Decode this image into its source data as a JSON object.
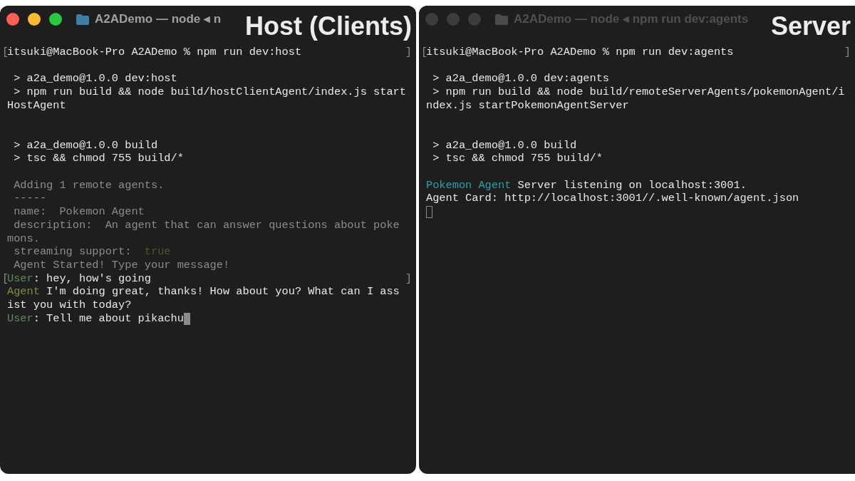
{
  "windows": [
    {
      "title": "A2ADemo — node ◂ n",
      "active": true,
      "overlay_label": "Host (Clients)",
      "lines": [
        {
          "kind": "text",
          "open_bracket": "[",
          "close_bracket": "]",
          "segments": [
            {
              "kind": "normal",
              "text": "itsuki@MacBook-Pro A2ADemo % npm run dev:host"
            }
          ]
        },
        {
          "kind": "blank"
        },
        {
          "kind": "text",
          "segments": [
            {
              "kind": "normal",
              "text": " > a2a_demo@1.0.0 dev:host"
            }
          ]
        },
        {
          "kind": "text",
          "segments": [
            {
              "kind": "normal",
              "text": " > npm run build && node build/hostClientAgent/index.js start"
            }
          ]
        },
        {
          "kind": "text",
          "segments": [
            {
              "kind": "normal",
              "text": "HostAgent"
            }
          ]
        },
        {
          "kind": "blank"
        },
        {
          "kind": "blank"
        },
        {
          "kind": "text",
          "segments": [
            {
              "kind": "normal",
              "text": " > a2a_demo@1.0.0 build"
            }
          ]
        },
        {
          "kind": "text",
          "segments": [
            {
              "kind": "normal",
              "text": " > tsc && chmod 755 build/*"
            }
          ]
        },
        {
          "kind": "blank"
        },
        {
          "kind": "text",
          "segments": [
            {
              "kind": "dim",
              "text": " Adding 1 remote agents."
            }
          ]
        },
        {
          "kind": "text",
          "segments": [
            {
              "kind": "dim",
              "text": " -----"
            }
          ]
        },
        {
          "kind": "text",
          "segments": [
            {
              "kind": "dim",
              "text": " name:  Pokemon Agent"
            }
          ]
        },
        {
          "kind": "text",
          "segments": [
            {
              "kind": "dim",
              "text": " description:  An agent that can answer questions about poke"
            }
          ]
        },
        {
          "kind": "text",
          "segments": [
            {
              "kind": "dim",
              "text": "mons."
            }
          ]
        },
        {
          "kind": "text",
          "segments": [
            {
              "kind": "dim",
              "text": " streaming support:  "
            },
            {
              "kind": "faint_olive",
              "text": "true"
            }
          ]
        },
        {
          "kind": "text",
          "segments": [
            {
              "kind": "dim",
              "text": " Agent Started! Type your message!"
            }
          ]
        },
        {
          "kind": "text",
          "open_bracket": "[",
          "close_bracket": "]",
          "segments": [
            {
              "kind": "green",
              "text": "User"
            },
            {
              "kind": "normal",
              "text": ": hey, how's going"
            }
          ]
        },
        {
          "kind": "text",
          "segments": [
            {
              "kind": "olive",
              "text": "Agent"
            },
            {
              "kind": "normal",
              "text": " I'm doing great, thanks! How about you? What can I ass"
            }
          ]
        },
        {
          "kind": "text",
          "segments": [
            {
              "kind": "normal",
              "text": "ist you with today?"
            }
          ]
        },
        {
          "kind": "input",
          "segments": [
            {
              "kind": "green",
              "text": "User"
            },
            {
              "kind": "normal",
              "text": ": Tell me about pikachu"
            }
          ]
        }
      ]
    },
    {
      "title": "A2ADemo — node ◂ npm run dev:agents",
      "active": false,
      "overlay_label": "Server",
      "lines": [
        {
          "kind": "text",
          "open_bracket": "[",
          "close_bracket": "]",
          "segments": [
            {
              "kind": "normal",
              "text": "itsuki@MacBook-Pro A2ADemo % npm run dev:agents"
            }
          ]
        },
        {
          "kind": "blank"
        },
        {
          "kind": "text",
          "segments": [
            {
              "kind": "normal",
              "text": " > a2a_demo@1.0.0 dev:agents"
            }
          ]
        },
        {
          "kind": "text",
          "segments": [
            {
              "kind": "normal",
              "text": " > npm run build && node build/remoteServerAgents/pokemonAgent/i"
            }
          ]
        },
        {
          "kind": "text",
          "segments": [
            {
              "kind": "normal",
              "text": "ndex.js startPokemonAgentServer"
            }
          ]
        },
        {
          "kind": "blank"
        },
        {
          "kind": "blank"
        },
        {
          "kind": "text",
          "segments": [
            {
              "kind": "normal",
              "text": " > a2a_demo@1.0.0 build"
            }
          ]
        },
        {
          "kind": "text",
          "segments": [
            {
              "kind": "normal",
              "text": " > tsc && chmod 755 build/*"
            }
          ]
        },
        {
          "kind": "blank"
        },
        {
          "kind": "text",
          "segments": [
            {
              "kind": "cyan",
              "text": "Pokemon Agent"
            },
            {
              "kind": "normal",
              "text": " Server listening on localhost:3001."
            }
          ]
        },
        {
          "kind": "text",
          "segments": [
            {
              "kind": "normal",
              "text": "Agent Card: http://localhost:3001//.well-known/agent.json"
            }
          ]
        },
        {
          "kind": "idle_cursor"
        }
      ]
    }
  ]
}
